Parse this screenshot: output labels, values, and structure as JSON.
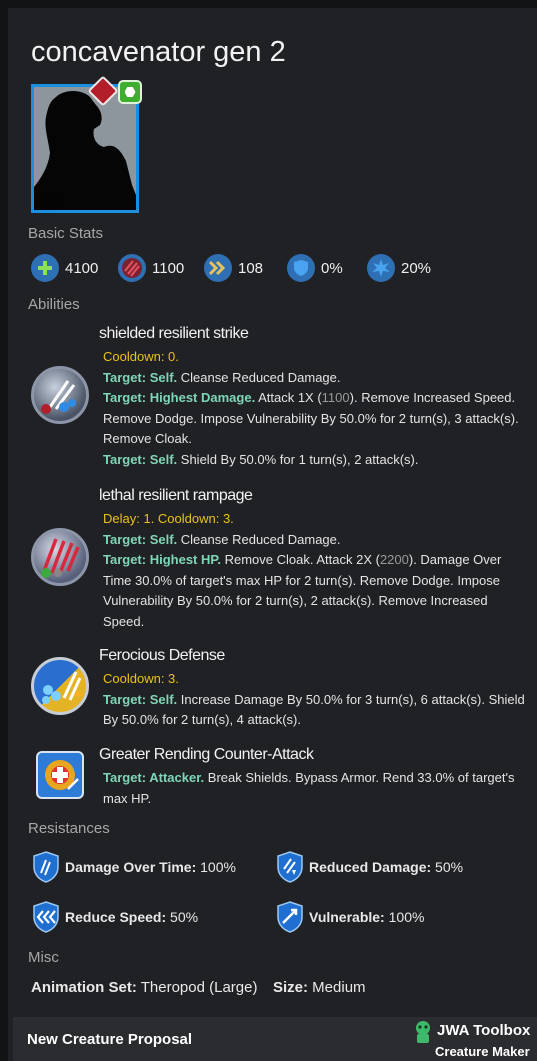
{
  "creature": {
    "name": "concavenator gen 2"
  },
  "sections": {
    "basic_stats": "Basic Stats",
    "abilities": "Abilities",
    "resistances": "Resistances",
    "misc": "Misc"
  },
  "stats": [
    {
      "icon": "health-icon",
      "value": "4100",
      "color": "#2e7fd0"
    },
    {
      "icon": "damage-icon",
      "value": "1100",
      "color": "#2e7fd0"
    },
    {
      "icon": "speed-icon",
      "value": "108",
      "color": "#2e7fd0"
    },
    {
      "icon": "armor-icon",
      "value": "0%",
      "color": "#2e7fd0"
    },
    {
      "icon": "critical-icon",
      "value": "20%",
      "color": "#2e7fd0"
    }
  ],
  "abilities": [
    {
      "name": "shielded resilient strike",
      "cooldown": "Cooldown: 0.",
      "l1_target": "Target: Self.",
      "l1_text": " Cleanse Reduced Damage.",
      "l2_target": "Target: Highest Damage.",
      "l2_text_a": " Attack 1X (",
      "l2_num": "1100",
      "l2_text_b": "). Remove Increased Speed. Remove Dodge. Impose Vulnerability By 50.0% for 2 turn(s), 3 attack(s). Remove Cloak.",
      "l3_target": "Target: Self.",
      "l3_text": " Shield By 50.0% for 1 turn(s), 2 attack(s)."
    },
    {
      "name": "lethal resilient rampage",
      "cooldown": "Delay: 1. Cooldown: 3.",
      "l1_target": "Target: Self.",
      "l1_text": " Cleanse Reduced Damage.",
      "l2_target": "Target: Highest HP.",
      "l2_text_a": " Remove Cloak. Attack 2X (",
      "l2_num": "2200",
      "l2_text_b": "). Damage Over Time 30.0% of target's max HP for 2 turn(s). Remove Dodge. Impose Vulnerability By 50.0% for 2 turn(s), 2 attack(s). Remove Increased Speed."
    },
    {
      "name": "Ferocious Defense",
      "cooldown": "Cooldown: 3.",
      "l1_target": "Target: Self.",
      "l1_text": " Increase Damage By 50.0% for 3 turn(s), 6 attack(s). Shield By 50.0% for 2 turn(s), 4 attack(s)."
    },
    {
      "name": "Greater Rending Counter-Attack",
      "l1_target": "Target: Attacker.",
      "l1_text": " Break Shields. Bypass Armor. Rend 33.0% of target's max HP."
    }
  ],
  "resistances": [
    {
      "label": "Damage Over Time:",
      "value": " 100%"
    },
    {
      "label": "Reduced Damage:",
      "value": " 50%"
    },
    {
      "label": "Reduce Speed:",
      "value": " 50%"
    },
    {
      "label": "Vulnerable:",
      "value": " 100%"
    }
  ],
  "misc": {
    "animation_label": "Animation Set:",
    "animation_value": " Theropod (Large)",
    "size_label": "Size:",
    "size_value": " Medium"
  },
  "footer": {
    "left": "New Creature Proposal",
    "brand": "JWA Toolbox",
    "sub": "Creature Maker"
  },
  "colors": {
    "accent": "#1a8fe0",
    "cooldown": "#e9c21d",
    "target": "#7fd6b7",
    "background": "#202124"
  }
}
